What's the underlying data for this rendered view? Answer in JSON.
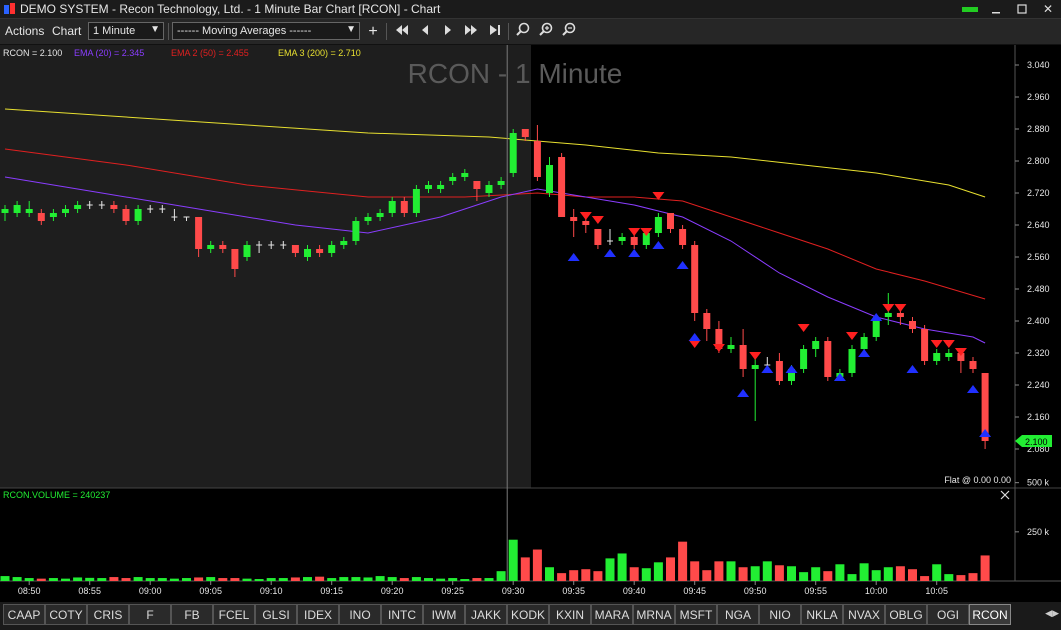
{
  "window": {
    "title": "DEMO SYSTEM - Recon Technology, Ltd. - 1 Minute Bar Chart [RCON] - Chart",
    "minimize_icon": "minimize-icon",
    "maximize_icon": "maximize-icon",
    "close_label": "✕"
  },
  "toolbar": {
    "menu_actions": "Actions",
    "menu_chart": "Chart",
    "interval_value": "1 Minute",
    "study_value": "------ Moving Averages ------",
    "add_label": "+",
    "nav_first": "⏮",
    "nav_prev": "◀",
    "nav_next": "▶",
    "nav_fwd": "⏭",
    "nav_last": "⏭",
    "zoom_icon": "magnifier-icon",
    "zoom_in_icon": "zoom-in-icon",
    "zoom_out_icon": "zoom-out-icon"
  },
  "chart": {
    "watermark": "RCON - 1 Minute",
    "legend": [
      {
        "label": "RCON = 2.100",
        "color": "#e6e6e6"
      },
      {
        "label": "EMA (20) = 2.345",
        "color": "#8a3dff"
      },
      {
        "label": "EMA 2 (50) = 2.455",
        "color": "#e02020"
      },
      {
        "label": "EMA 3 (200) = 2.710",
        "color": "#e8e030"
      }
    ],
    "last_price": "2.100",
    "position_text": "Flat @ 0.00  0.00",
    "volume_label": "RCON.VOLUME = 240237",
    "volume_ticks": [
      "500 k",
      "250 k"
    ],
    "colors": {
      "up": "#22ee33",
      "down": "#ff4a4a",
      "bg_left": "#1e1e1e",
      "bg_right": "#000000",
      "sell_marker": "#ff2020",
      "buy_marker": "#2030ff"
    }
  },
  "chart_data": {
    "type": "candlestick",
    "title": "RCON - 1 Minute",
    "ylim": [
      2.06,
      3.05
    ],
    "yticks": [
      3.04,
      2.96,
      2.88,
      2.8,
      2.72,
      2.64,
      2.56,
      2.48,
      2.4,
      2.32,
      2.24,
      2.16,
      2.08
    ],
    "xticks": [
      "08:50",
      "08:55",
      "09:00",
      "09:05",
      "09:10",
      "09:15",
      "09:20",
      "09:25",
      "09:30",
      "09:35",
      "09:40",
      "09:45",
      "09:50",
      "09:55",
      "10:00",
      "10:05"
    ],
    "xtick_bar_index": [
      2,
      7,
      12,
      17,
      22,
      27,
      32,
      37,
      42,
      47,
      52,
      57,
      62,
      67,
      72,
      77
    ],
    "bars": [
      [
        2.67,
        2.69,
        2.65,
        2.68
      ],
      [
        2.67,
        2.7,
        2.66,
        2.69
      ],
      [
        2.67,
        2.7,
        2.66,
        2.68
      ],
      [
        2.67,
        2.68,
        2.64,
        2.65
      ],
      [
        2.66,
        2.68,
        2.65,
        2.67
      ],
      [
        2.67,
        2.69,
        2.66,
        2.68
      ],
      [
        2.68,
        2.7,
        2.67,
        2.69
      ],
      [
        2.69,
        2.7,
        2.68,
        2.69
      ],
      [
        2.69,
        2.7,
        2.68,
        2.69
      ],
      [
        2.69,
        2.7,
        2.67,
        2.68
      ],
      [
        2.68,
        2.69,
        2.64,
        2.65
      ],
      [
        2.65,
        2.69,
        2.64,
        2.68
      ],
      [
        2.68,
        2.69,
        2.67,
        2.68
      ],
      [
        2.68,
        2.69,
        2.67,
        2.68
      ],
      [
        2.66,
        2.68,
        2.65,
        2.66
      ],
      [
        2.66,
        2.66,
        2.65,
        2.66
      ],
      [
        2.66,
        2.66,
        2.56,
        2.58
      ],
      [
        2.58,
        2.6,
        2.57,
        2.59
      ],
      [
        2.59,
        2.6,
        2.57,
        2.58
      ],
      [
        2.58,
        2.58,
        2.51,
        2.53
      ],
      [
        2.56,
        2.6,
        2.55,
        2.59
      ],
      [
        2.59,
        2.6,
        2.57,
        2.59
      ],
      [
        2.59,
        2.6,
        2.58,
        2.59
      ],
      [
        2.59,
        2.6,
        2.58,
        2.59
      ],
      [
        2.59,
        2.59,
        2.56,
        2.57
      ],
      [
        2.56,
        2.59,
        2.55,
        2.58
      ],
      [
        2.58,
        2.59,
        2.56,
        2.57
      ],
      [
        2.57,
        2.6,
        2.56,
        2.59
      ],
      [
        2.59,
        2.61,
        2.58,
        2.6
      ],
      [
        2.6,
        2.66,
        2.59,
        2.65
      ],
      [
        2.65,
        2.67,
        2.64,
        2.66
      ],
      [
        2.66,
        2.68,
        2.65,
        2.67
      ],
      [
        2.67,
        2.71,
        2.66,
        2.7
      ],
      [
        2.7,
        2.71,
        2.66,
        2.67
      ],
      [
        2.67,
        2.74,
        2.66,
        2.73
      ],
      [
        2.73,
        2.75,
        2.72,
        2.74
      ],
      [
        2.73,
        2.75,
        2.72,
        2.74
      ],
      [
        2.75,
        2.77,
        2.74,
        2.76
      ],
      [
        2.76,
        2.78,
        2.75,
        2.77
      ],
      [
        2.75,
        2.75,
        2.7,
        2.73
      ],
      [
        2.72,
        2.75,
        2.71,
        2.74
      ],
      [
        2.74,
        2.76,
        2.73,
        2.75
      ],
      [
        2.77,
        2.88,
        2.76,
        2.87
      ],
      [
        2.88,
        2.88,
        2.85,
        2.86
      ],
      [
        2.85,
        2.89,
        2.75,
        2.76
      ],
      [
        2.72,
        2.81,
        2.71,
        2.79
      ],
      [
        2.81,
        2.82,
        2.66,
        2.66
      ],
      [
        2.66,
        2.68,
        2.61,
        2.65
      ],
      [
        2.65,
        2.66,
        2.62,
        2.64
      ],
      [
        2.63,
        2.63,
        2.58,
        2.59
      ],
      [
        2.6,
        2.63,
        2.59,
        2.6
      ],
      [
        2.6,
        2.62,
        2.59,
        2.61
      ],
      [
        2.61,
        2.63,
        2.58,
        2.59
      ],
      [
        2.59,
        2.63,
        2.58,
        2.62
      ],
      [
        2.62,
        2.67,
        2.61,
        2.66
      ],
      [
        2.67,
        2.67,
        2.62,
        2.63
      ],
      [
        2.63,
        2.64,
        2.58,
        2.59
      ],
      [
        2.59,
        2.6,
        2.4,
        2.42
      ],
      [
        2.42,
        2.43,
        2.35,
        2.38
      ],
      [
        2.38,
        2.4,
        2.32,
        2.33
      ],
      [
        2.33,
        2.36,
        2.32,
        2.34
      ],
      [
        2.34,
        2.38,
        2.26,
        2.28
      ],
      [
        2.28,
        2.31,
        2.15,
        2.29
      ],
      [
        2.29,
        2.31,
        2.27,
        2.29
      ],
      [
        2.3,
        2.32,
        2.24,
        2.25
      ],
      [
        2.25,
        2.29,
        2.24,
        2.28
      ],
      [
        2.28,
        2.34,
        2.27,
        2.33
      ],
      [
        2.33,
        2.36,
        2.31,
        2.35
      ],
      [
        2.35,
        2.36,
        2.25,
        2.26
      ],
      [
        2.26,
        2.28,
        2.25,
        2.27
      ],
      [
        2.27,
        2.34,
        2.26,
        2.33
      ],
      [
        2.33,
        2.37,
        2.32,
        2.36
      ],
      [
        2.36,
        2.41,
        2.35,
        2.4
      ],
      [
        2.41,
        2.47,
        2.39,
        2.42
      ],
      [
        2.42,
        2.43,
        2.39,
        2.41
      ],
      [
        2.4,
        2.41,
        2.37,
        2.38
      ],
      [
        2.38,
        2.39,
        2.29,
        2.3
      ],
      [
        2.3,
        2.33,
        2.29,
        2.32
      ],
      [
        2.31,
        2.33,
        2.3,
        2.32
      ],
      [
        2.32,
        2.33,
        2.27,
        2.3
      ],
      [
        2.3,
        2.31,
        2.27,
        2.28
      ],
      [
        2.27,
        2.27,
        2.08,
        2.1
      ]
    ],
    "volume": [
      25,
      20,
      15,
      12,
      15,
      12,
      18,
      16,
      15,
      20,
      15,
      20,
      15,
      15,
      12,
      15,
      18,
      20,
      15,
      15,
      12,
      10,
      15,
      15,
      18,
      20,
      22,
      15,
      20,
      20,
      18,
      25,
      20,
      15,
      20,
      15,
      12,
      15,
      10,
      15,
      15,
      50,
      210,
      120,
      160,
      70,
      40,
      55,
      60,
      50,
      115,
      140,
      70,
      65,
      95,
      120,
      200,
      100,
      55,
      100,
      100,
      70,
      75,
      100,
      80,
      75,
      45,
      70,
      50,
      85,
      35,
      90,
      55,
      70,
      75,
      60,
      25,
      85,
      35,
      30,
      40,
      130
    ],
    "volume_ylim": [
      0,
      600
    ],
    "ema20": [
      [
        0,
        2.76
      ],
      [
        8,
        2.72
      ],
      [
        16,
        2.68
      ],
      [
        24,
        2.64
      ],
      [
        30,
        2.62
      ],
      [
        36,
        2.66
      ],
      [
        41,
        2.71
      ],
      [
        44,
        2.73
      ],
      [
        48,
        2.71
      ],
      [
        52,
        2.69
      ],
      [
        56,
        2.66
      ],
      [
        60,
        2.6
      ],
      [
        64,
        2.52
      ],
      [
        68,
        2.46
      ],
      [
        72,
        2.41
      ],
      [
        76,
        2.38
      ],
      [
        80,
        2.36
      ],
      [
        81,
        2.345
      ]
    ],
    "ema50": [
      [
        0,
        2.83
      ],
      [
        10,
        2.79
      ],
      [
        20,
        2.74
      ],
      [
        30,
        2.71
      ],
      [
        38,
        2.71
      ],
      [
        44,
        2.72
      ],
      [
        48,
        2.71
      ],
      [
        52,
        2.71
      ],
      [
        56,
        2.7
      ],
      [
        60,
        2.66
      ],
      [
        64,
        2.62
      ],
      [
        68,
        2.58
      ],
      [
        72,
        2.53
      ],
      [
        76,
        2.5
      ],
      [
        81,
        2.455
      ]
    ],
    "ema200": [
      [
        0,
        2.93
      ],
      [
        10,
        2.91
      ],
      [
        20,
        2.89
      ],
      [
        30,
        2.87
      ],
      [
        40,
        2.86
      ],
      [
        48,
        2.84
      ],
      [
        54,
        2.82
      ],
      [
        60,
        2.81
      ],
      [
        66,
        2.79
      ],
      [
        72,
        2.77
      ],
      [
        78,
        2.74
      ],
      [
        81,
        2.71
      ]
    ],
    "sell_markers": [
      [
        48,
        2.65
      ],
      [
        49,
        2.64
      ],
      [
        52,
        2.61
      ],
      [
        53,
        2.61
      ],
      [
        54,
        2.7
      ],
      [
        57,
        2.33
      ],
      [
        59,
        2.32
      ],
      [
        62,
        2.3
      ],
      [
        66,
        2.37
      ],
      [
        70,
        2.35
      ],
      [
        73,
        2.42
      ],
      [
        74,
        2.42
      ],
      [
        77,
        2.33
      ],
      [
        78,
        2.33
      ],
      [
        79,
        2.31
      ]
    ],
    "buy_markers": [
      [
        47,
        2.57
      ],
      [
        50,
        2.58
      ],
      [
        52,
        2.58
      ],
      [
        54,
        2.6
      ],
      [
        56,
        2.55
      ],
      [
        57,
        2.37
      ],
      [
        61,
        2.23
      ],
      [
        63,
        2.29
      ],
      [
        65,
        2.29
      ],
      [
        69,
        2.27
      ],
      [
        71,
        2.33
      ],
      [
        72,
        2.42
      ],
      [
        75,
        2.29
      ],
      [
        80,
        2.24
      ],
      [
        81,
        2.13
      ]
    ],
    "session_divider_bar": 42
  },
  "tabs": {
    "items": [
      "CAAP",
      "COTY",
      "CRIS",
      "F",
      "FB",
      "FCEL",
      "GLSI",
      "IDEX",
      "INO",
      "INTC",
      "IWM",
      "JAKK",
      "KODK",
      "KXIN",
      "MARA",
      "MRNA",
      "MSFT",
      "NGA",
      "NIO",
      "NKLA",
      "NVAX",
      "OBLG",
      "OGI",
      "RCON"
    ],
    "active": "RCON",
    "scroll_left": "◀",
    "scroll_right": "▶"
  }
}
